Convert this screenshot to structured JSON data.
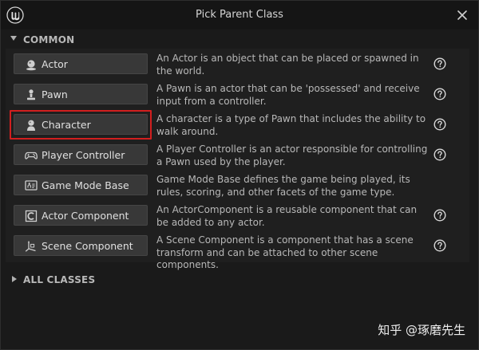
{
  "window": {
    "title": "Pick Parent Class",
    "close_icon": "close-icon"
  },
  "sections": {
    "common": {
      "label": "COMMON",
      "expanded": true
    },
    "all_classes": {
      "label": "ALL CLASSES",
      "expanded": false
    }
  },
  "classes": [
    {
      "label": "Actor",
      "icon": "actor-icon",
      "description": "An Actor is an object that can be placed or spawned in the world.",
      "selected": false
    },
    {
      "label": "Pawn",
      "icon": "pawn-icon",
      "description": "A Pawn is an actor that can be 'possessed' and receive input from a controller.",
      "selected": false
    },
    {
      "label": "Character",
      "icon": "character-icon",
      "description": "A character is a type of Pawn that includes the ability to walk around.",
      "selected": true
    },
    {
      "label": "Player Controller",
      "icon": "gamepad-icon",
      "description": "A Player Controller is an actor responsible for controlling a Pawn used by the player.",
      "selected": false
    },
    {
      "label": "Game Mode Base",
      "icon": "game-mode-icon",
      "description": "Game Mode Base defines the game being played, its rules, scoring, and other facets of the game type.",
      "selected": false
    },
    {
      "label": "Actor Component",
      "icon": "component-icon",
      "description": "An ActorComponent is a reusable component that can be added to any actor.",
      "selected": false
    },
    {
      "label": "Scene Component",
      "icon": "scene-component-icon",
      "description": "A Scene Component is a component that has a scene transform and can be attached to other scene components.",
      "selected": false
    }
  ],
  "watermark": "知乎 @琢磨先生",
  "colors": {
    "background": "#1a1a1a",
    "panel": "#1f1f1f",
    "button": "#383838",
    "selection_outline": "#d21f1f"
  }
}
